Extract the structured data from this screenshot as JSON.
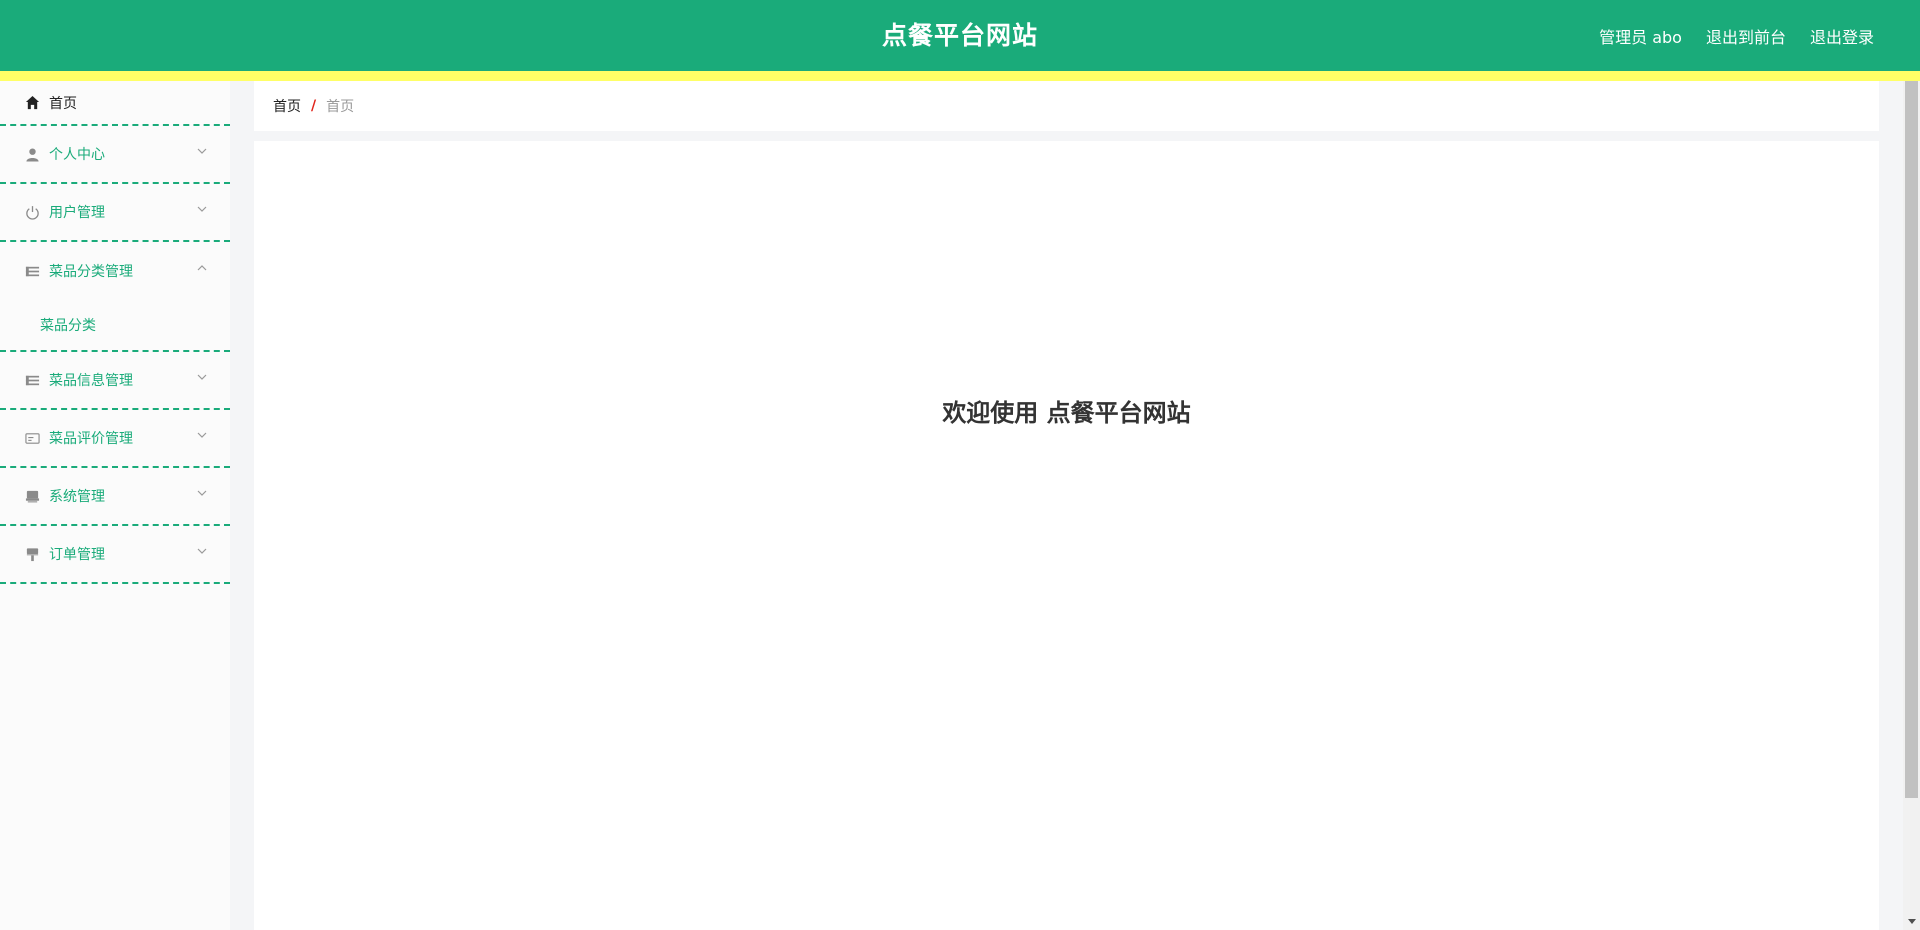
{
  "header": {
    "title": "点餐平台网站",
    "admin_role": "管理员",
    "admin_name": "abo",
    "to_front_label": "退出到前台",
    "logout_label": "退出登录",
    "bg_color": "#1aab7a",
    "strip_color": "#ffff66"
  },
  "sidebar": {
    "home": {
      "label": "首页",
      "icon": "home-icon"
    },
    "items": [
      {
        "label": "个人中心",
        "icon": "user-icon",
        "expanded": false
      },
      {
        "label": "用户管理",
        "icon": "power-icon",
        "expanded": false
      },
      {
        "label": "菜品分类管理",
        "icon": "list-icon",
        "expanded": true,
        "children": [
          "菜品分类"
        ]
      },
      {
        "label": "菜品信息管理",
        "icon": "list-icon",
        "expanded": false
      },
      {
        "label": "菜品评价管理",
        "icon": "card-icon",
        "expanded": false
      },
      {
        "label": "系统管理",
        "icon": "printer-icon",
        "expanded": false
      },
      {
        "label": "订单管理",
        "icon": "brush-icon",
        "expanded": false
      }
    ]
  },
  "breadcrumb": {
    "home": "首页",
    "separator": "/",
    "current": "首页"
  },
  "main": {
    "welcome": "欢迎使用 点餐平台网站"
  }
}
